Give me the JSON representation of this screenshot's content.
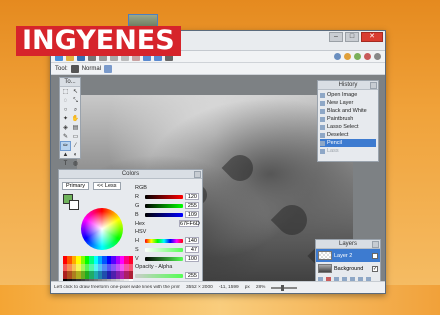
{
  "badge": {
    "text": "INGYENES",
    "color": "#d6242b"
  },
  "toolbar": {
    "tool_label": "Tool:",
    "blend_mode": "Normal"
  },
  "tools_panel": {
    "title": "To..."
  },
  "history": {
    "title": "History",
    "items": [
      {
        "label": "Open Image",
        "state": "normal"
      },
      {
        "label": "New Layer",
        "state": "normal"
      },
      {
        "label": "Black and White",
        "state": "normal"
      },
      {
        "label": "Paintbrush",
        "state": "normal"
      },
      {
        "label": "Lasso Select",
        "state": "normal"
      },
      {
        "label": "Deselect",
        "state": "normal"
      },
      {
        "label": "Pencil",
        "state": "selected"
      },
      {
        "label": "Lass",
        "state": "dim"
      }
    ]
  },
  "colors": {
    "title": "Colors",
    "primary_label": "Primary",
    "less_label": "<< Less",
    "rgb_label": "RGB",
    "rgb": {
      "r": "120",
      "g": "255",
      "b": "109"
    },
    "hex_label": "Hex",
    "hex_value": "67FF6D",
    "hsv_label": "HSV",
    "hsv": {
      "h": "140",
      "s": "47",
      "v": "100"
    },
    "opacity_label": "Opacity - Alpha",
    "opacity_value": "255",
    "primary_color": "#6fb35b"
  },
  "layers": {
    "title": "Layers",
    "items": [
      {
        "name": "Layer 2",
        "selected": true
      },
      {
        "name": "Background",
        "selected": false
      }
    ]
  },
  "status": {
    "hint": "Left click to draw freeform one-pixel wide lines with the primary color, right click to use the secondary color.",
    "size": "3552 × 2000",
    "coords": "-11, 1599",
    "unit": "px",
    "zoom": "28%"
  }
}
